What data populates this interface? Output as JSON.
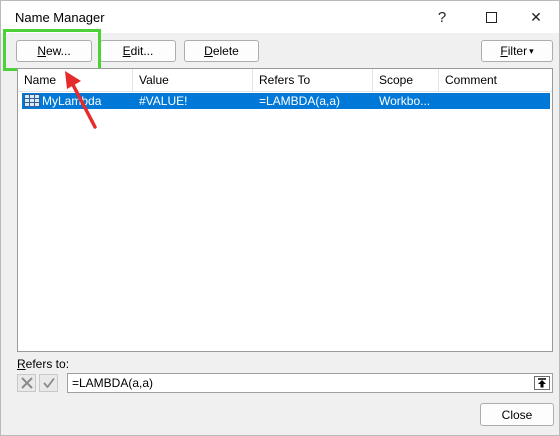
{
  "window": {
    "title": "Name Manager",
    "help_glyph": "?",
    "maximize_glyph": "☐",
    "close_glyph": "✕"
  },
  "toolbar": {
    "new": {
      "mnemonic": "N",
      "rest": "ew..."
    },
    "edit": {
      "mnemonic": "E",
      "rest": "dit..."
    },
    "delete": {
      "mnemonic": "D",
      "rest": "elete"
    },
    "filter": {
      "mnemonic": "F",
      "rest": "ilter",
      "arrow": "▾"
    }
  },
  "list": {
    "columns": [
      "Name",
      "Value",
      "Refers To",
      "Scope",
      "Comment"
    ],
    "rows": [
      {
        "name": "MyLambda",
        "value": "#VALUE!",
        "refers_to": "=LAMBDA(a,a)",
        "scope": "Workbo...",
        "comment": "",
        "selected": true,
        "icon": "named-range-icon"
      }
    ]
  },
  "refers_to": {
    "label_mnemonic": "R",
    "label_rest": "efers to:",
    "value": "=LAMBDA(a,a)"
  },
  "footer": {
    "close_label": "Close"
  },
  "annotations": {
    "highlight_color": "#4cd137",
    "arrow_color": "#e52b2b"
  },
  "colors": {
    "selection": "#0078d7"
  }
}
